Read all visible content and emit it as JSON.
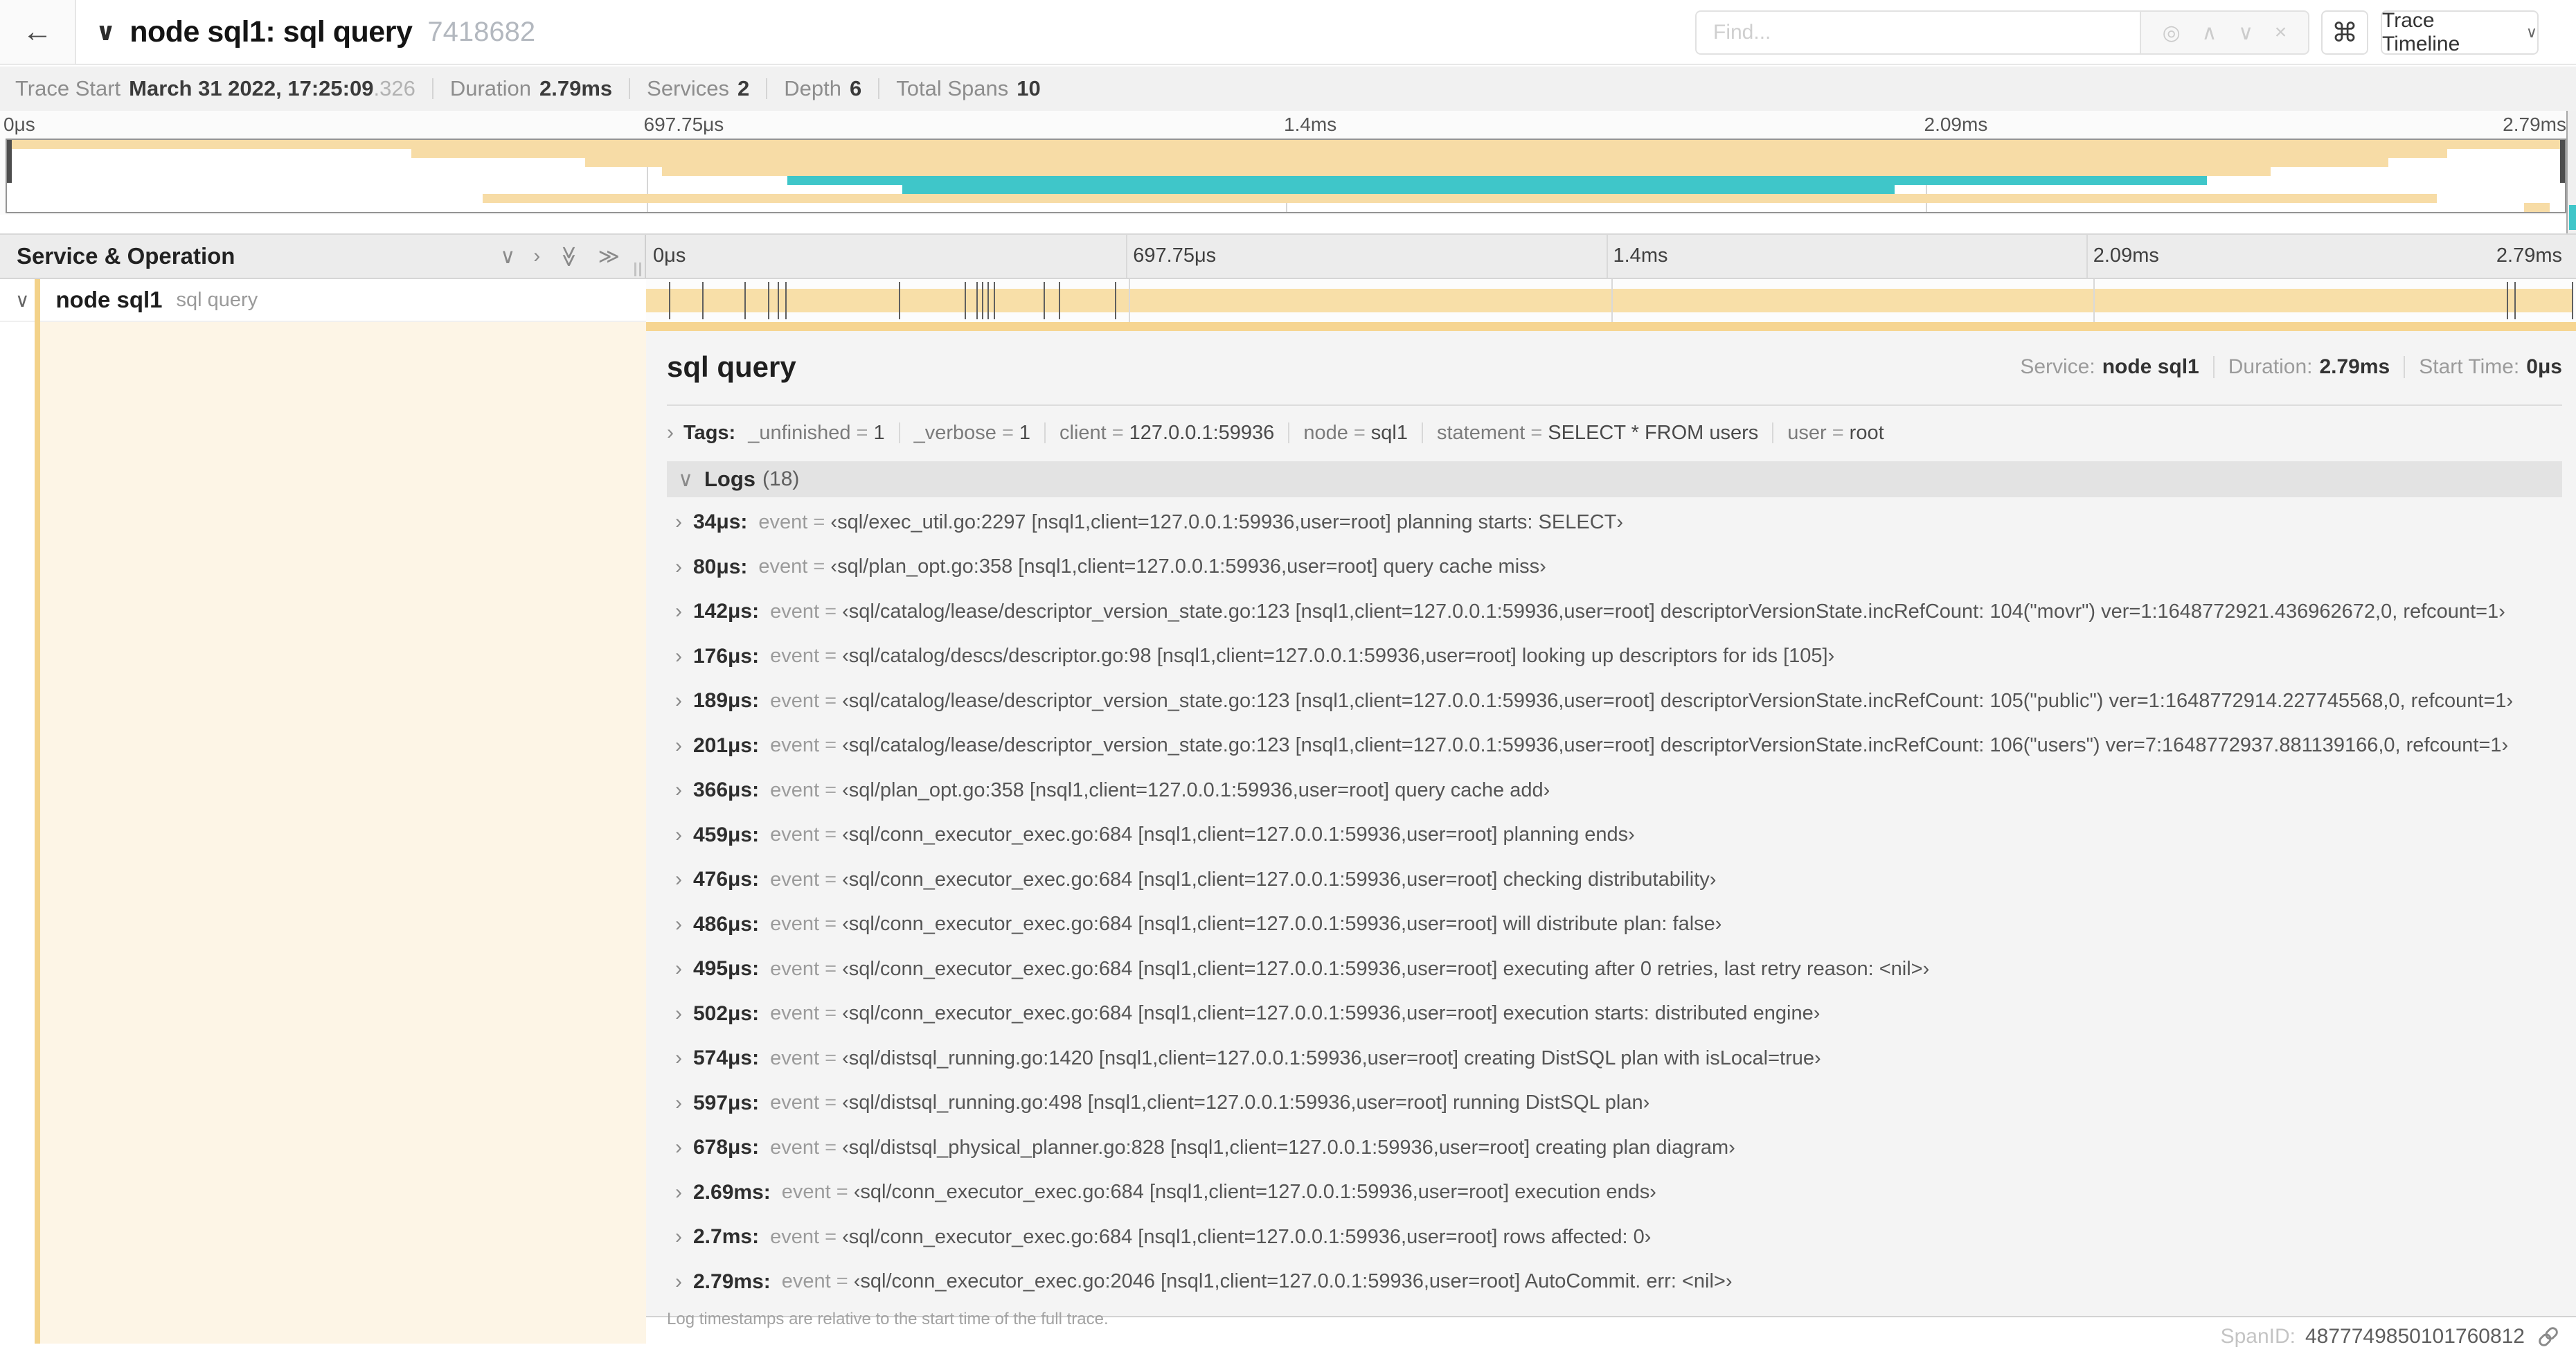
{
  "header": {
    "back_icon": "←",
    "title": "node sql1: sql query",
    "trace_id": "7418682",
    "find_placeholder": "Find...",
    "find_icons": [
      "◎",
      "∧",
      "∨",
      "×"
    ],
    "shortcut_key": "⌘",
    "view_dropdown": "Trace Timeline"
  },
  "summary": {
    "items": [
      {
        "label": "Trace Start",
        "value": "March 31 2022, 17:25:09",
        "suffix": ".326"
      },
      {
        "label": "Duration",
        "value": "2.79ms"
      },
      {
        "label": "Services",
        "value": "2"
      },
      {
        "label": "Depth",
        "value": "6"
      },
      {
        "label": "Total Spans",
        "value": "10"
      }
    ]
  },
  "timeline": {
    "left_header": "Service & Operation",
    "ticks": [
      {
        "pct": 0,
        "label": "0μs"
      },
      {
        "pct": 25,
        "label": "697.75μs"
      },
      {
        "pct": 50,
        "label": "1.4ms"
      },
      {
        "pct": 75,
        "label": "2.09ms"
      },
      {
        "pct": 100,
        "label": "2.79ms",
        "align": "right"
      }
    ],
    "gridlines_pct": [
      25,
      50,
      75
    ]
  },
  "minimap": {
    "bars": [
      {
        "row": 0,
        "start": 0,
        "end": 100,
        "color": "tan"
      },
      {
        "row": 1,
        "start": 15.8,
        "end": 95.4,
        "color": "tan"
      },
      {
        "row": 2,
        "start": 22.6,
        "end": 93.1,
        "color": "tan"
      },
      {
        "row": 3,
        "start": 25.6,
        "end": 88.5,
        "color": "tan"
      },
      {
        "row": 4,
        "start": 30.5,
        "end": 86.0,
        "color": "teal"
      },
      {
        "row": 5,
        "start": 35.0,
        "end": 73.8,
        "color": "teal"
      },
      {
        "row": 6,
        "start": 18.6,
        "end": 95.0,
        "color": "tan"
      },
      {
        "row": 7,
        "start": 98.4,
        "end": 99.4,
        "color": "tan"
      }
    ]
  },
  "span_row": {
    "service": "node sql1",
    "operation": "sql query",
    "bar_start_pct": 0,
    "bar_end_pct": 100,
    "log_ticks_pct": [
      1.2,
      2.9,
      5.1,
      6.3,
      6.8,
      7.2,
      13.1,
      16.5,
      17.1,
      17.4,
      17.7,
      18.0,
      20.6,
      21.4,
      24.3,
      96.4,
      96.8,
      99.8
    ]
  },
  "detail": {
    "title": "sql query",
    "meta": [
      {
        "label": "Service:",
        "value": "node sql1"
      },
      {
        "label": "Duration:",
        "value": "2.79ms"
      },
      {
        "label": "Start Time:",
        "value": "0μs"
      }
    ],
    "tags": {
      "label": "Tags:",
      "pairs": [
        {
          "key": "_unfinished",
          "value": "1"
        },
        {
          "key": "_verbose",
          "value": "1"
        },
        {
          "key": "client",
          "value": "127.0.0.1:59936"
        },
        {
          "key": "node",
          "value": "sql1"
        },
        {
          "key": "statement",
          "value": "SELECT * FROM users"
        },
        {
          "key": "user",
          "value": "root"
        }
      ]
    },
    "logs": {
      "label": "Logs",
      "count": "(18)",
      "entries": [
        {
          "ts": "34μs:",
          "key": "event",
          "value": "‹sql/exec_util.go:2297 [nsql1,client=127.0.0.1:59936,user=root] planning starts: SELECT›"
        },
        {
          "ts": "80μs:",
          "key": "event",
          "value": "‹sql/plan_opt.go:358 [nsql1,client=127.0.0.1:59936,user=root] query cache miss›"
        },
        {
          "ts": "142μs:",
          "key": "event",
          "value": "‹sql/catalog/lease/descriptor_version_state.go:123 [nsql1,client=127.0.0.1:59936,user=root] descriptorVersionState.incRefCount: 104(\"movr\") ver=1:1648772921.436962672,0, refcount=1›"
        },
        {
          "ts": "176μs:",
          "key": "event",
          "value": "‹sql/catalog/descs/descriptor.go:98 [nsql1,client=127.0.0.1:59936,user=root] looking up descriptors for ids [105]›"
        },
        {
          "ts": "189μs:",
          "key": "event",
          "value": "‹sql/catalog/lease/descriptor_version_state.go:123 [nsql1,client=127.0.0.1:59936,user=root] descriptorVersionState.incRefCount: 105(\"public\") ver=1:1648772914.227745568,0, refcount=1›"
        },
        {
          "ts": "201μs:",
          "key": "event",
          "value": "‹sql/catalog/lease/descriptor_version_state.go:123 [nsql1,client=127.0.0.1:59936,user=root] descriptorVersionState.incRefCount: 106(\"users\") ver=7:1648772937.881139166,0, refcount=1›"
        },
        {
          "ts": "366μs:",
          "key": "event",
          "value": "‹sql/plan_opt.go:358 [nsql1,client=127.0.0.1:59936,user=root] query cache add›"
        },
        {
          "ts": "459μs:",
          "key": "event",
          "value": "‹sql/conn_executor_exec.go:684 [nsql1,client=127.0.0.1:59936,user=root] planning ends›"
        },
        {
          "ts": "476μs:",
          "key": "event",
          "value": "‹sql/conn_executor_exec.go:684 [nsql1,client=127.0.0.1:59936,user=root] checking distributability›"
        },
        {
          "ts": "486μs:",
          "key": "event",
          "value": "‹sql/conn_executor_exec.go:684 [nsql1,client=127.0.0.1:59936,user=root] will distribute plan: false›"
        },
        {
          "ts": "495μs:",
          "key": "event",
          "value": "‹sql/conn_executor_exec.go:684 [nsql1,client=127.0.0.1:59936,user=root] executing after 0 retries, last retry reason: <nil>›"
        },
        {
          "ts": "502μs:",
          "key": "event",
          "value": "‹sql/conn_executor_exec.go:684 [nsql1,client=127.0.0.1:59936,user=root] execution starts: distributed engine›"
        },
        {
          "ts": "574μs:",
          "key": "event",
          "value": "‹sql/distsql_running.go:1420 [nsql1,client=127.0.0.1:59936,user=root] creating DistSQL plan with isLocal=true›"
        },
        {
          "ts": "597μs:",
          "key": "event",
          "value": "‹sql/distsql_running.go:498 [nsql1,client=127.0.0.1:59936,user=root] running DistSQL plan›"
        },
        {
          "ts": "678μs:",
          "key": "event",
          "value": "‹sql/distsql_physical_planner.go:828 [nsql1,client=127.0.0.1:59936,user=root] creating plan diagram›"
        },
        {
          "ts": "2.69ms:",
          "key": "event",
          "value": "‹sql/conn_executor_exec.go:684 [nsql1,client=127.0.0.1:59936,user=root] execution ends›"
        },
        {
          "ts": "2.7ms:",
          "key": "event",
          "value": "‹sql/conn_executor_exec.go:684 [nsql1,client=127.0.0.1:59936,user=root] rows affected: 0›"
        },
        {
          "ts": "2.79ms:",
          "key": "event",
          "value": "‹sql/conn_executor_exec.go:2046 [nsql1,client=127.0.0.1:59936,user=root] AutoCommit. err: <nil>›"
        }
      ]
    },
    "footer": "Log timestamps are relative to the start time of the full trace.",
    "span_id_label": "SpanID:",
    "span_id": "4877749850101760812"
  },
  "colors": {
    "tan": "#f7dca6",
    "teal": "#3fc6c9",
    "accent": "#f3d289",
    "cream": "#fdf5e6"
  }
}
